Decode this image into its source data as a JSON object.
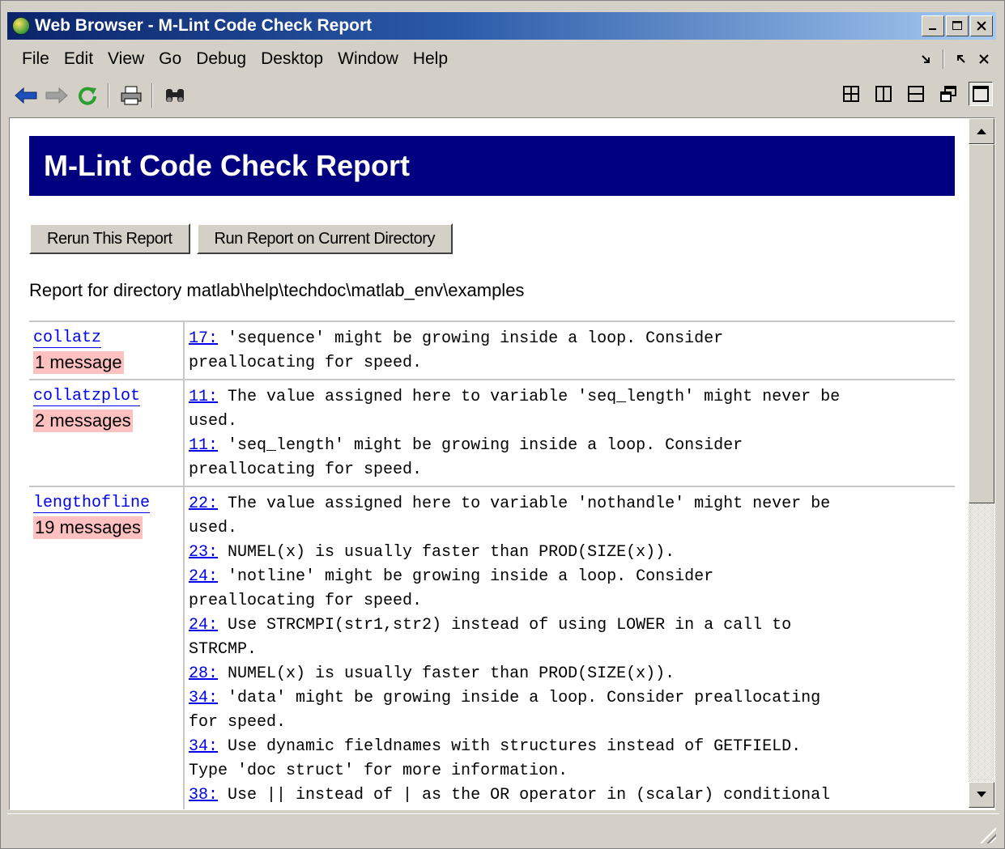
{
  "window": {
    "title": "Web Browser - M-Lint Code Check Report"
  },
  "menu": {
    "items": [
      "File",
      "Edit",
      "View",
      "Go",
      "Debug",
      "Desktop",
      "Window",
      "Help"
    ]
  },
  "report": {
    "heading": "M-Lint Code Check Report",
    "rerun_label": "Rerun This Report",
    "run_current_label": "Run Report on Current Directory",
    "directory_line": "Report for directory  matlab\\help\\techdoc\\matlab_env\\examples",
    "files": [
      {
        "name": "collatz",
        "count": "1 message",
        "messages": [
          {
            "line": "17:",
            "text": " 'sequence' might be growing inside a loop. Consider\npreallocating for speed."
          }
        ]
      },
      {
        "name": "collatzplot",
        "count": "2 messages",
        "messages": [
          {
            "line": "11:",
            "text": " The value assigned here to variable 'seq_length' might never be\nused."
          },
          {
            "line": "11:",
            "text": " 'seq_length' might be growing inside a loop. Consider\npreallocating for speed."
          }
        ]
      },
      {
        "name": "lengthofline",
        "count": "19 messages",
        "messages": [
          {
            "line": "22:",
            "text": " The value assigned here to variable 'nothandle' might never be\nused."
          },
          {
            "line": "23:",
            "text": " NUMEL(x) is usually faster than PROD(SIZE(x))."
          },
          {
            "line": "24:",
            "text": " 'notline' might be growing inside a loop. Consider\npreallocating for speed."
          },
          {
            "line": "24:",
            "text": " Use STRCMPI(str1,str2) instead of using LOWER in a call to\nSTRCMP."
          },
          {
            "line": "28:",
            "text": " NUMEL(x) is usually faster than PROD(SIZE(x))."
          },
          {
            "line": "34:",
            "text": " 'data' might be growing inside a loop. Consider preallocating\nfor speed."
          },
          {
            "line": "34:",
            "text": " Use dynamic fieldnames with structures instead of GETFIELD.\nType 'doc struct' for more information."
          },
          {
            "line": "38:",
            "text": " Use || instead of | as the OR operator in (scalar) conditional"
          }
        ]
      }
    ]
  },
  "icons": {
    "back": "back-arrow-icon",
    "forward": "forward-arrow-icon",
    "refresh": "refresh-icon",
    "print": "print-icon",
    "find": "binoculars-icon",
    "layouts": [
      "tile-grid-icon",
      "tile-columns-icon",
      "tile-rows-icon",
      "float-icon",
      "maximize-icon"
    ]
  },
  "colors": {
    "header_bg": "#000080",
    "count_bg": "#ffc0c0",
    "link": "#0000ee"
  }
}
